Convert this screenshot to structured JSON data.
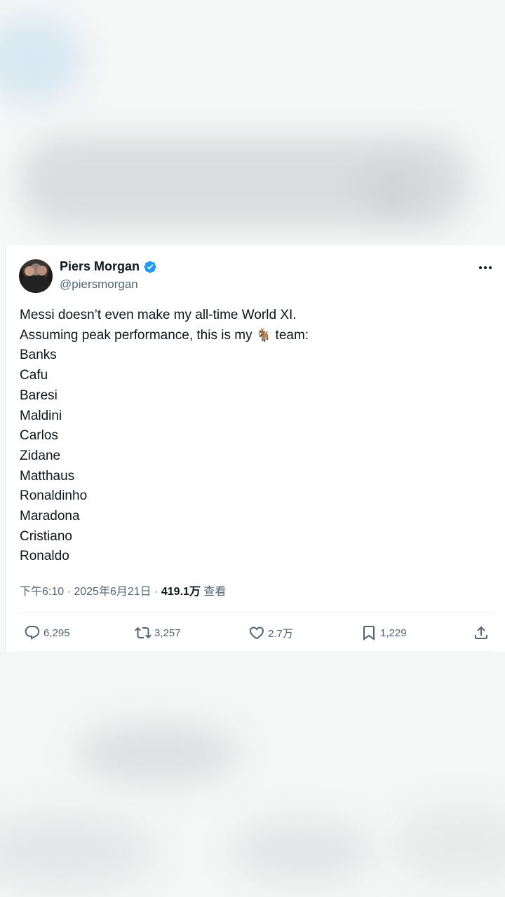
{
  "tweet": {
    "display_name": "Piers Morgan",
    "handle": "@piersmorgan",
    "verified": true,
    "lines": {
      "l1": "Messi doesn’t even make my all-time World XI.",
      "l2_before": "Assuming peak performance, this is my ",
      "l2_emoji": "🐐",
      "l2_after": " team:",
      "l3": "Banks",
      "l4": "Cafu",
      "l5": "Baresi",
      "l6": "Maldini",
      "l7": "Carlos",
      "l8": "Zidane",
      "l9": "Matthaus",
      "l10": "Ronaldinho",
      "l11": "Maradona",
      "l12": "Cristiano",
      "l13": "Ronaldo"
    },
    "time_text": "下午6:10 · 2025年6月21日 · ",
    "views_count": "419.1万",
    "views_label": " 查看",
    "stats": {
      "replies": "6,295",
      "retweets": "3,257",
      "likes": "2.7万",
      "bookmarks": "1,229"
    }
  },
  "colors": {
    "accent": "#1d9bf0",
    "text_primary": "#0f1419",
    "text_secondary": "#536471"
  },
  "icons": [
    "verified-badge-icon",
    "more-icon",
    "reply-icon",
    "retweet-icon",
    "like-icon",
    "bookmark-icon",
    "share-icon"
  ]
}
